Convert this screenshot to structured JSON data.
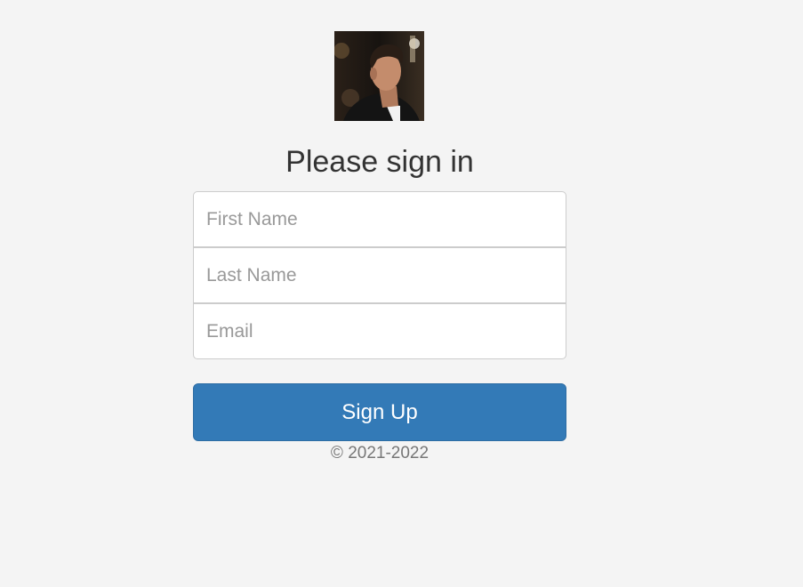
{
  "form": {
    "heading": "Please sign in",
    "first_name_placeholder": "First Name",
    "last_name_placeholder": "Last Name",
    "email_placeholder": "Email",
    "submit_label": "Sign Up"
  },
  "footer": {
    "copyright": "© 2021-2022"
  },
  "colors": {
    "background": "#f4f4f4",
    "primary_button": "#337ab7",
    "heading_text": "#333333",
    "footer_text": "#777777"
  }
}
